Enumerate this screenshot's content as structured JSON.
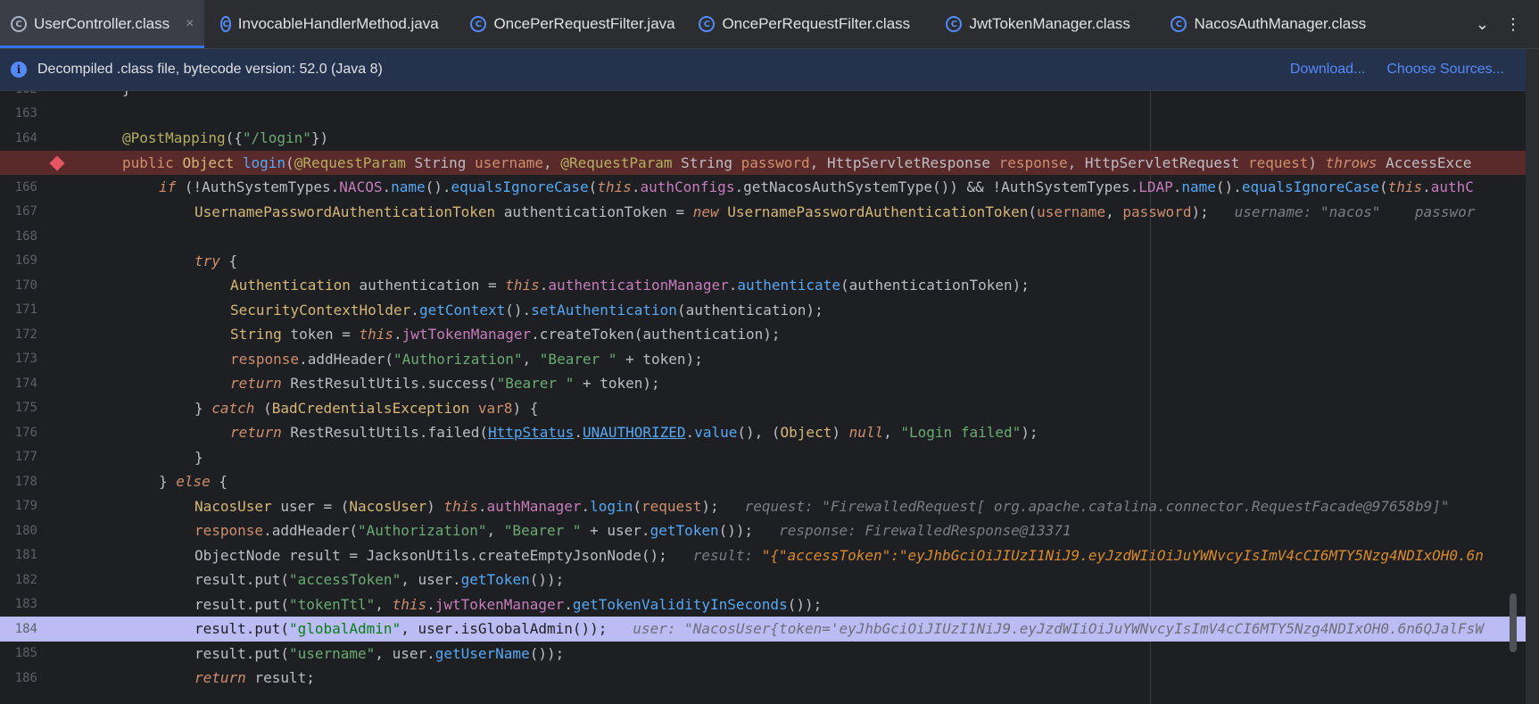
{
  "tabs": [
    {
      "label": "UserController.class",
      "active": true
    },
    {
      "label": "InvocableHandlerMethod.java"
    },
    {
      "label": "OncePerRequestFilter.java"
    },
    {
      "label": "OncePerRequestFilter.class"
    },
    {
      "label": "JwtTokenManager.class"
    },
    {
      "label": "NacosAuthManager.class"
    }
  ],
  "tab_close": "×",
  "tab_tools": {
    "chevron": "⌄",
    "more": "⋮"
  },
  "banner": {
    "message": "Decompiled .class file, bytecode version: 52.0 (Java 8)",
    "download": "Download...",
    "choose_sources": "Choose Sources..."
  },
  "editor": {
    "lines": [
      {
        "num": "162",
        "text": "}"
      },
      {
        "num": "163",
        "text": ""
      },
      {
        "num": "164",
        "text": "@PostMapping({\"/login\"})"
      },
      {
        "num": "165",
        "text": "public Object login(@RequestParam String username, @RequestParam String password, HttpServletResponse response, HttpServletRequest request) throws AccessExce"
      },
      {
        "num": "166",
        "text": "if (!AuthSystemTypes.NACOS.name().equalsIgnoreCase(this.authConfigs.getNacosAuthSystemType()) && !AuthSystemTypes.LDAP.name().equalsIgnoreCase(this.authC"
      },
      {
        "num": "167",
        "text": "UsernamePasswordAuthenticationToken authenticationToken = new UsernamePasswordAuthenticationToken(username, password);",
        "hint": "username: \"nacos\"    passwor"
      },
      {
        "num": "168",
        "text": ""
      },
      {
        "num": "169",
        "text": "try {"
      },
      {
        "num": "170",
        "text": "Authentication authentication = this.authenticationManager.authenticate(authenticationToken);"
      },
      {
        "num": "171",
        "text": "SecurityContextHolder.getContext().setAuthentication(authentication);"
      },
      {
        "num": "172",
        "text": "String token = this.jwtTokenManager.createToken(authentication);"
      },
      {
        "num": "173",
        "text": "response.addHeader(\"Authorization\", \"Bearer \" + token);"
      },
      {
        "num": "174",
        "text": "return RestResultUtils.success(\"Bearer \" + token);"
      },
      {
        "num": "175",
        "text": "} catch (BadCredentialsException var8) {"
      },
      {
        "num": "176",
        "text": "return RestResultUtils.failed(HttpStatus.UNAUTHORIZED.value(), (Object) null, \"Login failed\");"
      },
      {
        "num": "177",
        "text": "}"
      },
      {
        "num": "178",
        "text": "} else {"
      },
      {
        "num": "179",
        "text": "NacosUser user = (NacosUser) this.authManager.login(request);",
        "hint": "request: \"FirewalledRequest[ org.apache.catalina.connector.RequestFacade@97658b9]\""
      },
      {
        "num": "180",
        "text": "response.addHeader(\"Authorization\", \"Bearer \" + user.getToken());",
        "hint": "response: FirewalledResponse@13371"
      },
      {
        "num": "181",
        "text": "ObjectNode result = JacksonUtils.createEmptyJsonNode();",
        "hint": "result: ",
        "hint_value": "\"{\"accessToken\":\"eyJhbGciOiJIUzI1NiJ9.eyJzdWIiOiJuYWNvcyIsImV4cCI6MTY5Nzg4NDIxOH0.6n"
      },
      {
        "num": "182",
        "text": "result.put(\"accessToken\", user.getToken());"
      },
      {
        "num": "183",
        "text": "result.put(\"tokenTtl\", this.jwtTokenManager.getTokenValidityInSeconds());"
      },
      {
        "num": "184",
        "text": "result.put(\"globalAdmin\", user.isGlobalAdmin());",
        "hint": "user: \"NacosUser{token='eyJhbGciOiJIUzI1NiJ9.eyJzdWIiOiJuYWNvcyIsImV4cCI6MTY5Nzg4NDIxOH0.6n6QJalFsW"
      },
      {
        "num": "185",
        "text": "result.put(\"username\", user.getUserName());"
      },
      {
        "num": "186",
        "text": "return result;"
      }
    ]
  },
  "icons": {
    "tab": "class-icon",
    "banner": "info-icon",
    "breakpoint": "breakpoint-icon"
  }
}
